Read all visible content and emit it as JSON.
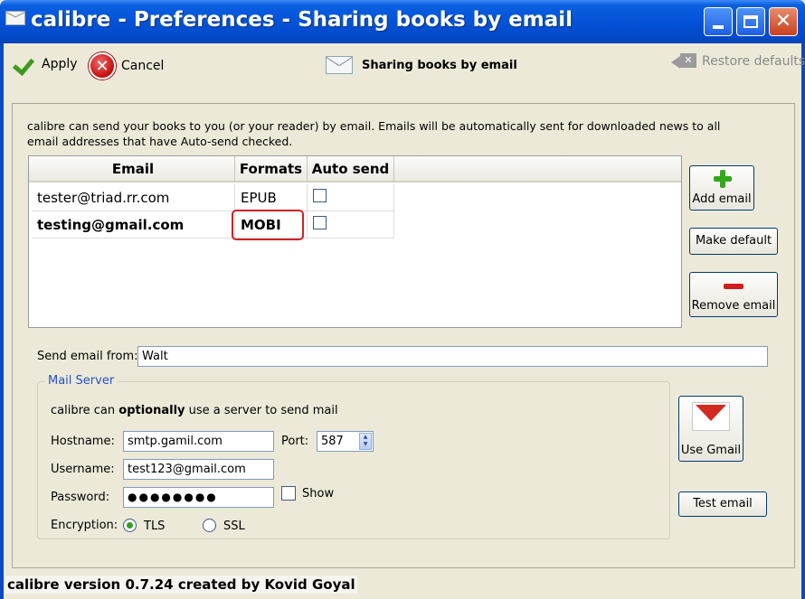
{
  "window": {
    "title": "calibre - Preferences - Sharing books by email"
  },
  "toolbar": {
    "apply_label": "Apply",
    "cancel_label": "Cancel",
    "section_title": "Sharing books by email",
    "restore_label": "Restore defaults"
  },
  "intro_text": "calibre can send your books to you (or your reader) by email. Emails will be automatically sent for downloaded news to all email addresses that have Auto-send checked.",
  "table": {
    "headers": [
      "Email",
      "Formats",
      "Auto send"
    ],
    "rows": [
      {
        "email": "tester@triad.rr.com",
        "formats": "EPUB",
        "auto_send": false
      },
      {
        "email": "testing@gmail.com",
        "formats": "MOBI",
        "auto_send": false
      }
    ]
  },
  "side_buttons": {
    "add_email": "Add email",
    "make_default": "Make default",
    "remove_email": "Remove email"
  },
  "send_from": {
    "label": "Send email from:",
    "value": "Walt"
  },
  "mail_server": {
    "group_title": "Mail Server",
    "intro_pre": "calibre can ",
    "intro_bold": "optionally",
    "intro_post": " use a server to send mail",
    "hostname_label": "Hostname:",
    "hostname": "smtp.gamil.com",
    "port_label": "Port:",
    "port": "587",
    "username_label": "Username:",
    "username": "test123@gmail.com",
    "password_label": "Password:",
    "password_masked": "●●●●●●●●",
    "show_label": "Show",
    "encryption_label": "Encryption:",
    "tls_label": "TLS",
    "ssl_label": "SSL",
    "encryption_selected": "TLS"
  },
  "gmail_button": "Use Gmail",
  "test_email_button": "Test email",
  "status_text": "calibre version 0.7.24 created by Kovid Goyal",
  "colors": {
    "titlebar": "#0453d8",
    "accent_red": "#d41f1f",
    "accent_green": "#34a81c",
    "group_title": "#2452c8"
  }
}
